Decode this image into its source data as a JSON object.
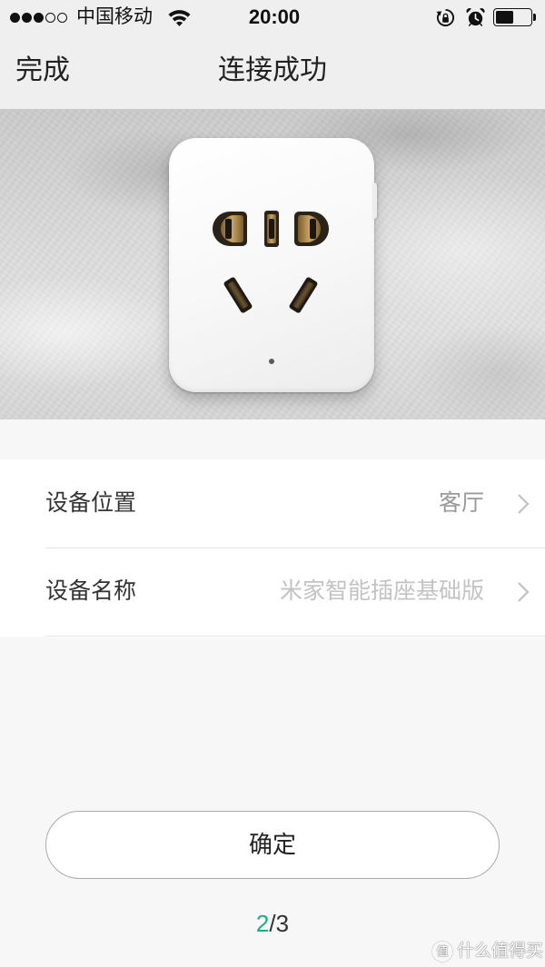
{
  "status_bar": {
    "signal": {
      "filled": 3,
      "total": 5
    },
    "carrier": "中国移动",
    "time": "20:00",
    "battery_level": 0.5,
    "icons": {
      "signal": "signal-dots-icon",
      "wifi": "wifi-icon",
      "rotation_lock": "rotation-lock-icon",
      "alarm": "alarm-icon",
      "battery": "battery-icon"
    }
  },
  "nav": {
    "done_label": "完成",
    "title": "连接成功"
  },
  "settings": {
    "rows": [
      {
        "label": "设备位置",
        "value": "客厅"
      },
      {
        "label": "设备名称",
        "placeholder": "米家智能插座基础版"
      }
    ],
    "chevron_icon": "chevron-right-icon"
  },
  "confirm_button": {
    "label": "确定"
  },
  "pager": {
    "current": "2",
    "separator": "/",
    "total": "3"
  },
  "watermark": {
    "logo_char": "值",
    "text": "什么值得买"
  },
  "colors": {
    "accent": "#1bae7e",
    "bar_bg": "#efeff0",
    "page_bg": "#f7f7f7",
    "value_text": "#9a9a9a",
    "placeholder_text": "#c3c3c3"
  }
}
